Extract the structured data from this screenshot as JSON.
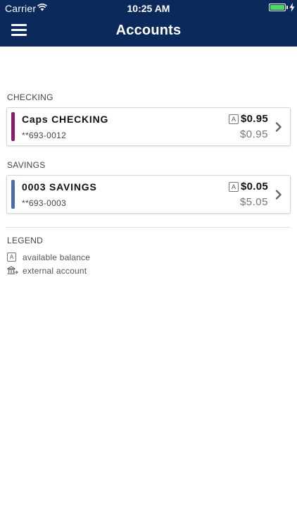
{
  "status_bar": {
    "carrier": "Carrier",
    "time": "10:25 AM",
    "icons": [
      "wifi-icon",
      "battery-icon",
      "charging-bolt-icon"
    ]
  },
  "nav": {
    "title": "Accounts",
    "menu_icon": "hamburger-menu-icon"
  },
  "sections": [
    {
      "label": "CHECKING",
      "account": {
        "name": "Caps CHECKING",
        "number": "**693-0012",
        "available_badge": "A",
        "available_balance": "$0.95",
        "current_balance": "$0.95",
        "color": "#8b1a6f"
      }
    },
    {
      "label": "SAVINGS",
      "account": {
        "name": "0003 SAVINGS",
        "number": "**693-0003",
        "available_badge": "A",
        "available_balance": "$0.05",
        "current_balance": "$5.05",
        "color": "#4a6fa8"
      }
    }
  ],
  "legend": {
    "title": "LEGEND",
    "items": [
      {
        "badge": "A",
        "icon": "available-balance-icon",
        "label": "available balance"
      },
      {
        "icon": "external-account-icon",
        "label": "external account"
      }
    ]
  },
  "colors": {
    "header_bg": "#0b2a5b",
    "battery_green": "#4cd964"
  }
}
